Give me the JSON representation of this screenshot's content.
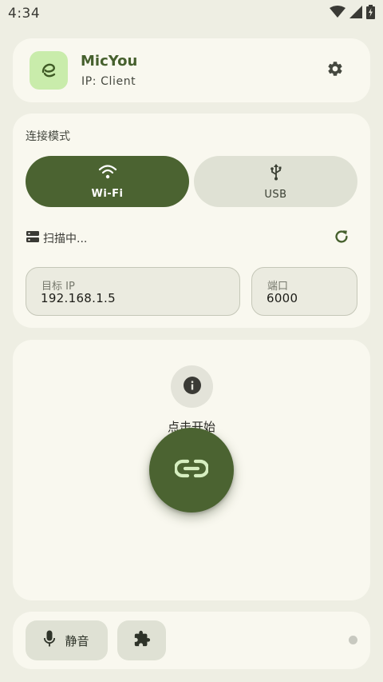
{
  "status_bar": {
    "time": "4:34",
    "icons": [
      "wifi-icon",
      "cellular-signal-icon",
      "battery-charging-icon"
    ]
  },
  "header": {
    "app_name": "MicYou",
    "ip_line": "IP:  Client",
    "logo_icon": "app-logo-icon",
    "settings_icon": "gear-icon"
  },
  "connection": {
    "title": "连接模式",
    "modes": [
      {
        "label": "Wi-Fi",
        "icon": "wifi-icon",
        "selected": true
      },
      {
        "label": "USB",
        "icon": "usb-icon",
        "selected": false
      }
    ],
    "scan_status": "扫描中...",
    "target_ip": {
      "label": "目标 IP",
      "value": "192.168.1.5"
    },
    "port": {
      "label": "端口",
      "value": "6000"
    }
  },
  "main": {
    "hint": "点击开始",
    "info_icon": "info-icon",
    "connect_icon": "link-icon"
  },
  "bottom": {
    "mute_label": "静音",
    "mic_icon": "microphone-icon",
    "plugin_icon": "puzzle-icon"
  },
  "colors": {
    "primary": "#4b6331",
    "background": "#eeeee3",
    "surface": "#f9f8ef",
    "logo_bg": "#c9ecab",
    "tonal": "#dfe1d4"
  }
}
